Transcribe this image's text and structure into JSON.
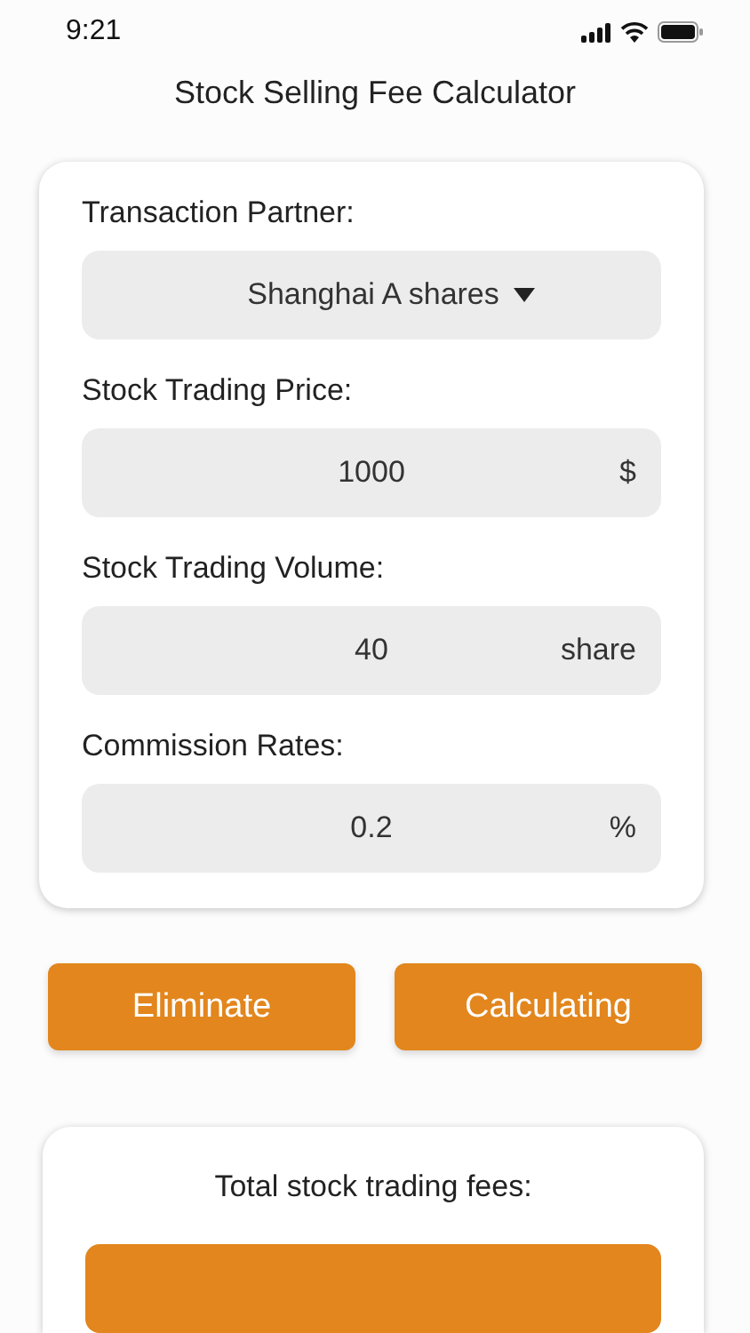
{
  "status_bar": {
    "time": "9:21"
  },
  "title": "Stock Selling Fee Calculator",
  "form": [
    {
      "kind": "select",
      "label": "Transaction Partner:",
      "value": "Shanghai A shares"
    },
    {
      "kind": "input",
      "label": "Stock Trading Price:",
      "value": "1000",
      "unit": "$"
    },
    {
      "kind": "input",
      "label": "Stock Trading Volume:",
      "value": "40",
      "unit": "share"
    },
    {
      "kind": "input",
      "label": "Commission Rates:",
      "value": "0.2",
      "unit": "%"
    }
  ],
  "buttons": [
    "Eliminate",
    "Calculating"
  ],
  "result": {
    "label": "Total stock trading fees:"
  }
}
